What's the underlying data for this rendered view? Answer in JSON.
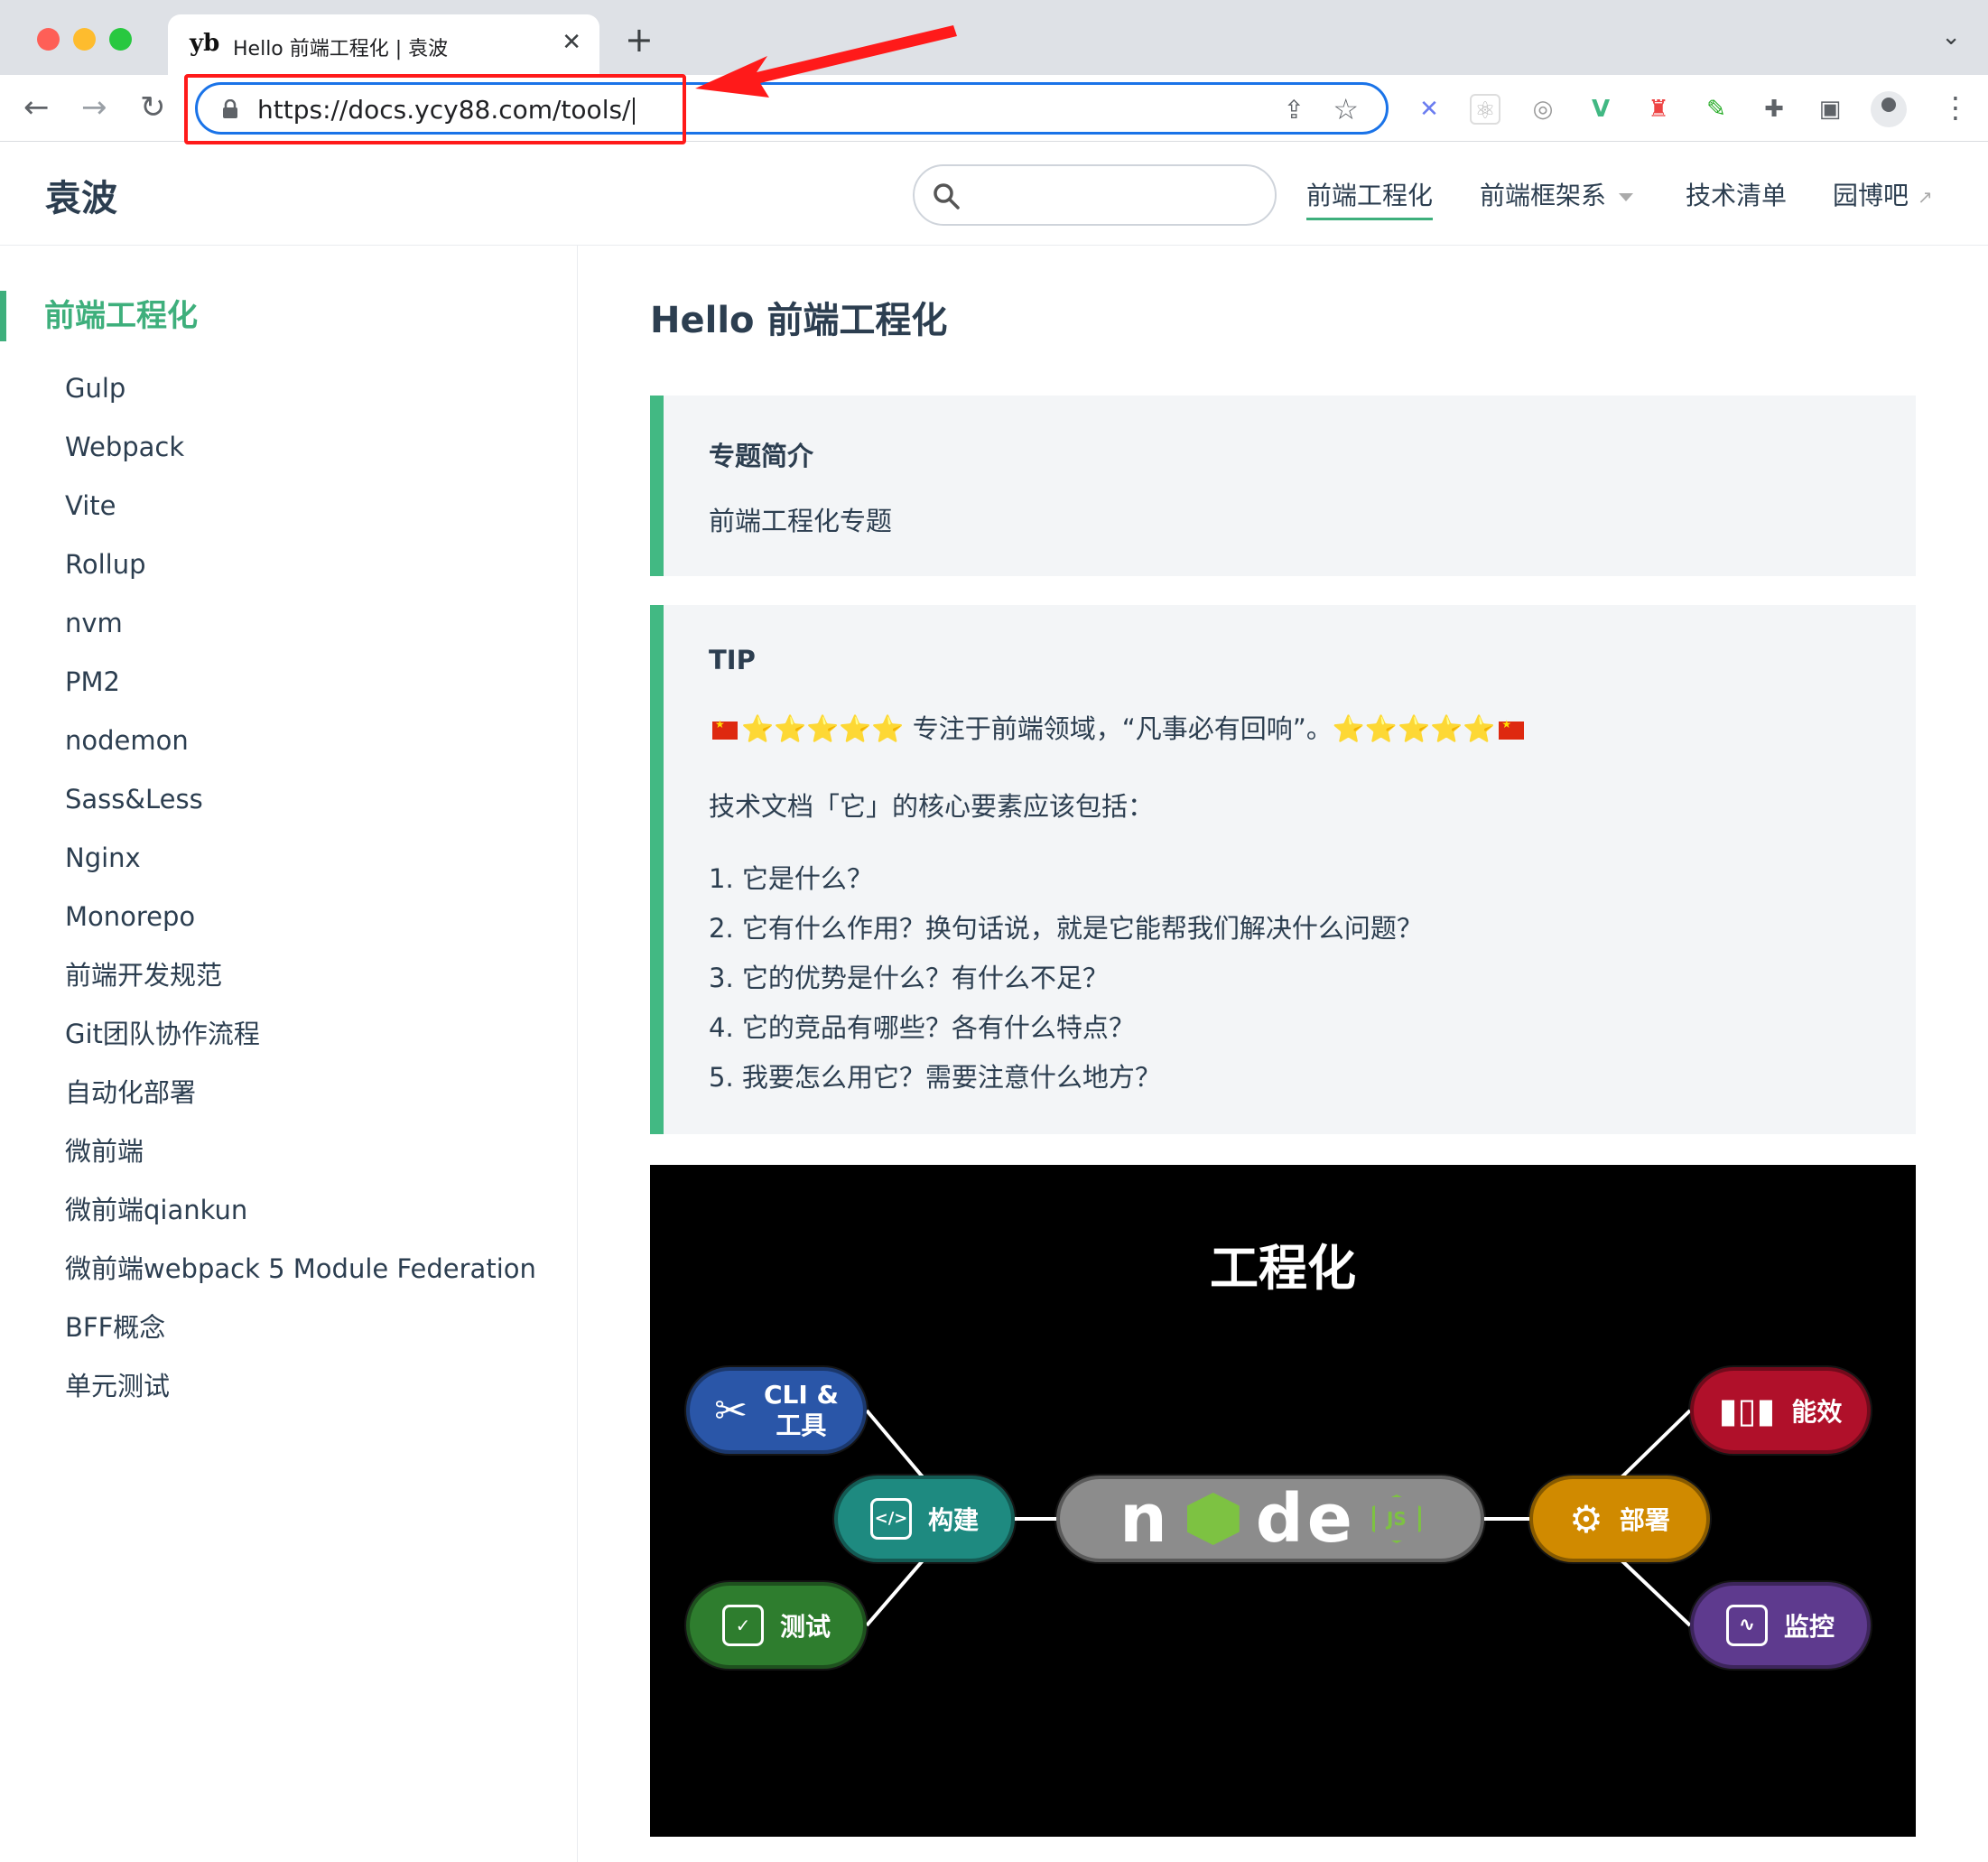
{
  "browser": {
    "tab": {
      "favicon_text": "yb",
      "title": "Hello 前端工程化 | 袁波",
      "close": "✕"
    },
    "new_tab": "+",
    "tabs_menu": "⌄",
    "url": "https://docs.ycy88.com/tools/",
    "extensions": [
      "x-extension",
      "react-devtools",
      "eyedropper-extension",
      "vue-devtools",
      "lighthouse-extension",
      "color-picker-extension",
      "puzzle-icon",
      "reading-list-icon"
    ]
  },
  "site": {
    "title": "袁波",
    "search": {
      "placeholder": ""
    },
    "nav": [
      {
        "label": "前端工程化",
        "active": true
      },
      {
        "label": "前端框架系",
        "dropdown": true
      },
      {
        "label": "技术清单"
      },
      {
        "label": "园博吧",
        "external": true
      }
    ]
  },
  "sidebar": {
    "heading": "前端工程化",
    "items": [
      "Gulp",
      "Webpack",
      "Vite",
      "Rollup",
      "nvm",
      "PM2",
      "nodemon",
      "Sass&Less",
      "Nginx",
      "Monorepo",
      "前端开发规范",
      "Git团队协作流程",
      "自动化部署",
      "微前端",
      "微前端qiankun",
      "微前端webpack 5 Module Federation",
      "BFF概念",
      "单元测试"
    ]
  },
  "main": {
    "heading": "Hello 前端工程化",
    "intro": {
      "title": "专题简介",
      "text": "前端工程化专题"
    },
    "tip": {
      "title": "TIP",
      "stars": "⭐⭐⭐⭐⭐",
      "motto": " 专注于前端领域，“凡事必有回响”。",
      "lead": "技术文档「它」的核心要素应该包括：",
      "list": [
        "1. 它是什么？",
        "2. 它有什么作用？换句话说，就是它能帮我们解决什么问题？",
        "3. 它的优势是什么？有什么不足？",
        "4. 它的竞品有哪些？各有什么特点？",
        "5. 我要怎么用它？需要注意什么地方？"
      ]
    },
    "diagram": {
      "title": "工程化",
      "center_word": "node",
      "center_badge": "JS",
      "nodes": {
        "cli": "CLI &\n工具",
        "build": "构建",
        "test": "测试",
        "perf": "能效",
        "deploy": "部署",
        "monitor": "监控"
      },
      "colors": {
        "cli": "#2a56a8",
        "build": "#1e8a80",
        "test": "#2e7d2e",
        "perf": "#b0102a",
        "deploy": "#d08a00",
        "monitor": "#5e3a8e",
        "node_green": "#7dc242"
      }
    }
  },
  "colors": {
    "accent": "#3eaf7c",
    "annotation": "#ff1a1a",
    "focus_ring": "#1a73e8"
  }
}
